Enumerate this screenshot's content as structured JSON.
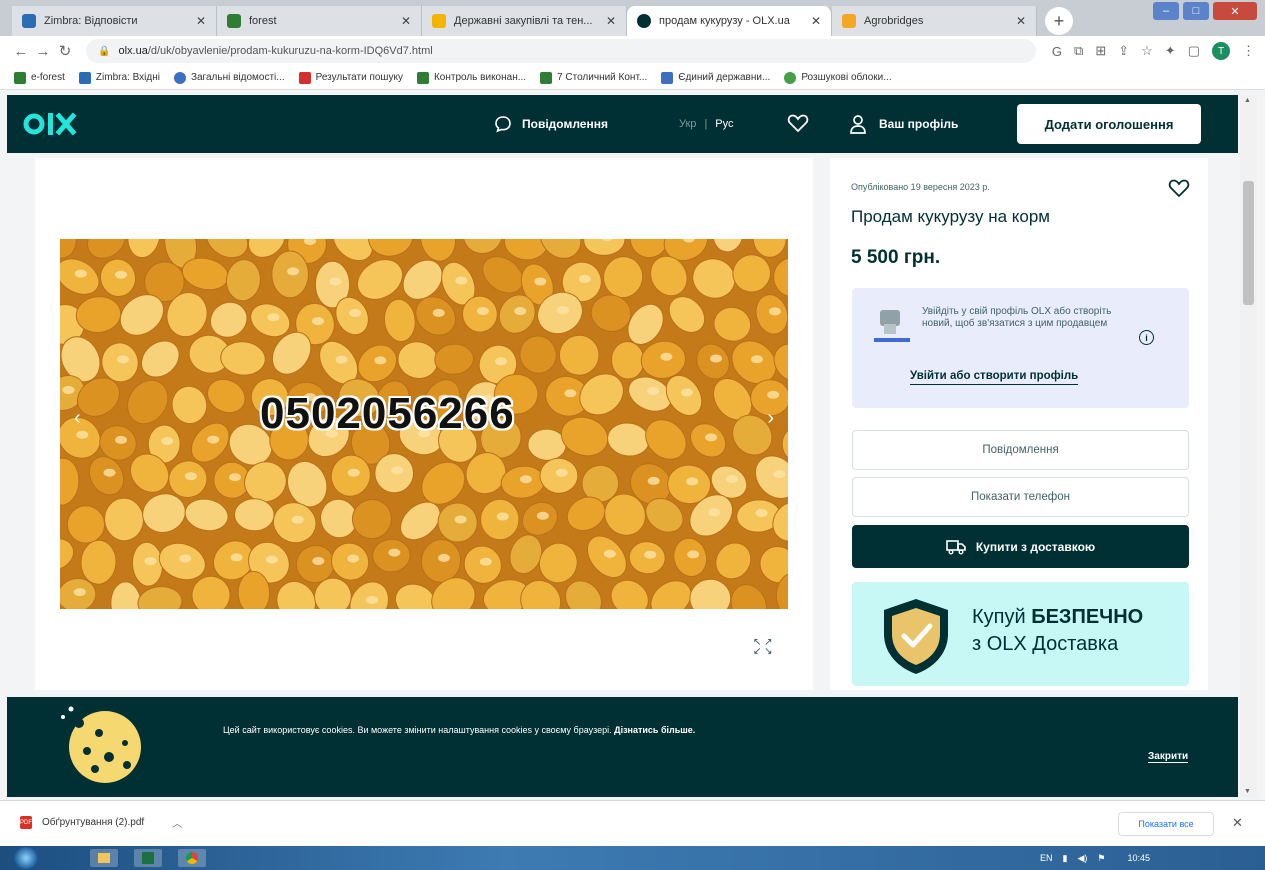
{
  "browser": {
    "tabs": [
      {
        "label": "Zimbra: Відповісти",
        "color": "#2a6db5",
        "active": false
      },
      {
        "label": "forest",
        "color": "#2e7d32",
        "active": false
      },
      {
        "label": "Державні закупівлі та тен...",
        "color": "#f4b400",
        "active": false
      },
      {
        "label": "продам кукурузу - OLX.ua",
        "color": "#23e5db",
        "active": true
      },
      {
        "label": "Agrobridges",
        "color": "#f5a623",
        "active": false
      }
    ],
    "url_domain": "olx.ua",
    "url_path": "/d/uk/obyavlenie/prodam-kukuruzu-na-korm-IDQ6Vd7.html",
    "profile_initial": "T",
    "bookmarks": [
      {
        "label": "e-forest",
        "color": "#2e7d32"
      },
      {
        "label": "Zimbra: Вхідні",
        "color": "#2a6db5"
      },
      {
        "label": "Загальні відомості...",
        "color": "#3c6fc2"
      },
      {
        "label": "Результати пошуку",
        "color": "#d32f2f"
      },
      {
        "label": "Контроль виконан...",
        "color": "#2e7d32"
      },
      {
        "label": "7 Столичний Конт...",
        "color": "#2e7d32"
      },
      {
        "label": "Єдиний державни...",
        "color": "#3c6fc2"
      },
      {
        "label": "Розшукові облоки...",
        "color": "#43a047"
      }
    ]
  },
  "header": {
    "messages_label": "Повідомлення",
    "lang_ukr": "Укр",
    "lang_sep": "|",
    "lang_rus": "Рус",
    "profile_label": "Ваш профіль",
    "add_listing_label": "Додати оголошення"
  },
  "listing": {
    "phone_overlay": "0502056266",
    "posted_date": "Опубліковано 19 вересня 2023 р.",
    "title": "Продам кукурузу на корм",
    "price": "5 500 грн.",
    "login_prompt": "Увійдіть у свій профіль OLX або створіть новий, щоб зв'язатися з цим продавцем",
    "login_link": "Увійти або створити профіль",
    "message_button": "Повідомлення",
    "show_phone_button": "Показати телефон",
    "buy_delivery_button": "Купити з доставкою",
    "promo_line1_a": "Купуй ",
    "promo_line1_b": "БЕЗПЕЧНО",
    "promo_line2": "з OLX Доставка"
  },
  "cookie_banner": {
    "text": "Цей сайт використовує cookies. Ви можете змінити налаштування cookies у своєму браузері. ",
    "more_link": "Дізнатись більше.",
    "close_label": "Закрити"
  },
  "downloads": {
    "file_name": "Обґрунтування (2).pdf",
    "show_all": "Показати все"
  },
  "taskbar": {
    "lang": "EN",
    "time": "10:45"
  },
  "colors": {
    "olx_dark": "#002f34",
    "olx_teal": "#23e5db",
    "promo_bg": "#c8f8f6"
  }
}
